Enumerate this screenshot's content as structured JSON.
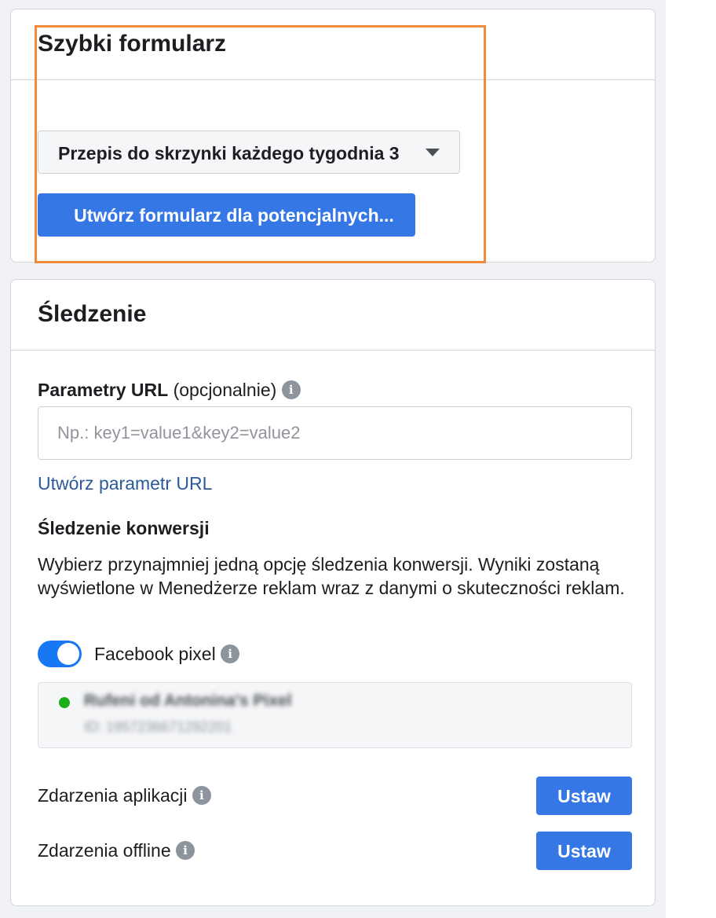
{
  "quick_form": {
    "title": "Szybki formularz",
    "dropdown_value": "Przepis do skrzynki każdego tygodnia 3",
    "create_button_label": "Utwórz formularz dla potencjalnych..."
  },
  "tracking": {
    "title": "Śledzenie",
    "url_params": {
      "label": "Parametry URL",
      "label_suffix": "(opcjonalnie)",
      "placeholder": "Np.: key1=value1&key2=value2"
    },
    "create_url_link": "Utwórz parametr URL",
    "conversion": {
      "heading": "Śledzenie konwersji",
      "description": "Wybierz przynajmniej jedną opcję śledzenia konwersji. Wyniki zostaną wyświetlone w Menedżerze reklam wraz z danymi o skuteczności reklam."
    },
    "pixel": {
      "toggle_label": "Facebook pixel",
      "toggle_on": true,
      "name": "Rufeni od Antonina's Pixel",
      "id_text": "ID: 1957236671292201",
      "status_color": "#1bae1b"
    },
    "app_events": {
      "label": "Zdarzenia aplikacji",
      "button": "Ustaw"
    },
    "offline_events": {
      "label": "Zdarzenia offline",
      "button": "Ustaw"
    }
  },
  "icons": {
    "info": "i"
  },
  "colors": {
    "primary": "#3578e5",
    "highlight": "#f28a3a",
    "link": "#2c5a9c",
    "toggle": "#1877f2"
  }
}
